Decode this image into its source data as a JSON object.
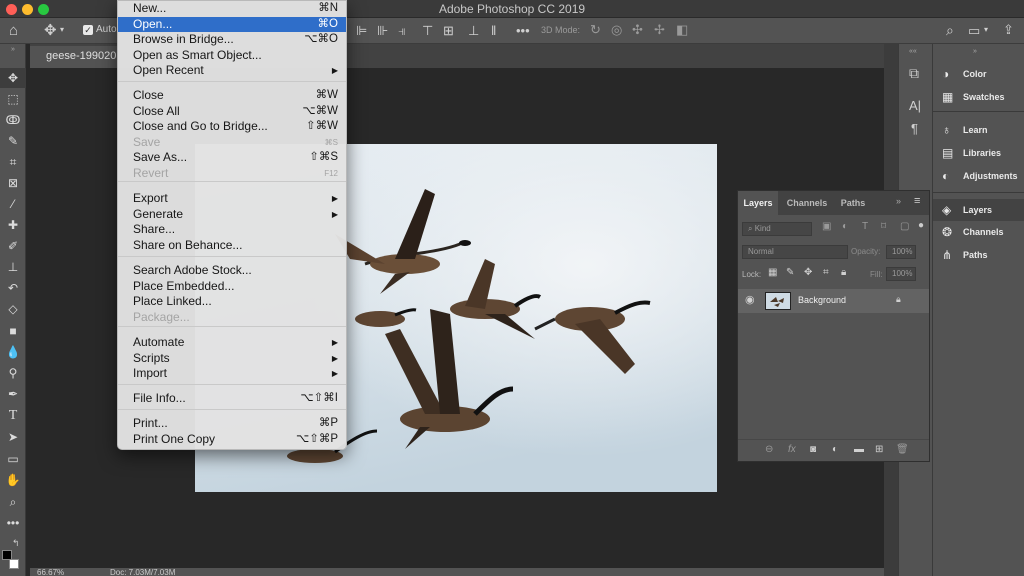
{
  "app": {
    "title": "Adobe Photoshop CC 2019",
    "traffic_lights": [
      "#ff5f57",
      "#febc2e",
      "#28c840"
    ]
  },
  "options_bar": {
    "home_icon": "home-icon",
    "move_icon": "move-icon",
    "auto_select_label": "Auto",
    "mode_3d_label": "3D Mode:",
    "search_icon": "search-icon",
    "workspace_icon": "workspace-icon",
    "share_icon": "share-icon"
  },
  "document": {
    "tab_label": "geese-199020"
  },
  "status_bar": {
    "zoom": "66.67%",
    "doc_size": "Doc: 7.03M/7.03M"
  },
  "file_menu": {
    "items": [
      {
        "label": "New...",
        "shortcut": "⌘N",
        "enabled": true
      },
      {
        "label": "Open...",
        "shortcut": "⌘O",
        "enabled": true,
        "highlighted": true
      },
      {
        "label": "Browse in Bridge...",
        "shortcut": "⌥⌘O",
        "enabled": true
      },
      {
        "label": "Open as Smart Object...",
        "shortcut": "",
        "enabled": true
      },
      {
        "label": "Open Recent",
        "shortcut": "▶",
        "enabled": true
      },
      {
        "label": "Close",
        "shortcut": "⌘W",
        "enabled": true
      },
      {
        "label": "Close All",
        "shortcut": "⌥⌘W",
        "enabled": true
      },
      {
        "label": "Close and Go to Bridge...",
        "shortcut": "⇧⌘W",
        "enabled": true
      },
      {
        "label": "Save",
        "shortcut": "⌘S",
        "enabled": false
      },
      {
        "label": "Save As...",
        "shortcut": "⇧⌘S",
        "enabled": true
      },
      {
        "label": "Revert",
        "shortcut": "F12",
        "enabled": false
      },
      {
        "label": "Export",
        "shortcut": "▶",
        "enabled": true
      },
      {
        "label": "Generate",
        "shortcut": "▶",
        "enabled": true
      },
      {
        "label": "Share...",
        "shortcut": "",
        "enabled": true
      },
      {
        "label": "Share on Behance...",
        "shortcut": "",
        "enabled": true
      },
      {
        "label": "Search Adobe Stock...",
        "shortcut": "",
        "enabled": true
      },
      {
        "label": "Place Embedded...",
        "shortcut": "",
        "enabled": true
      },
      {
        "label": "Place Linked...",
        "shortcut": "",
        "enabled": true
      },
      {
        "label": "Package...",
        "shortcut": "",
        "enabled": false
      },
      {
        "label": "Automate",
        "shortcut": "▶",
        "enabled": true
      },
      {
        "label": "Scripts",
        "shortcut": "▶",
        "enabled": true
      },
      {
        "label": "Import",
        "shortcut": "▶",
        "enabled": true
      },
      {
        "label": "File Info...",
        "shortcut": "⌥⇧⌘I",
        "enabled": true
      },
      {
        "label": "Print...",
        "shortcut": "⌘P",
        "enabled": true
      },
      {
        "label": "Print One Copy",
        "shortcut": "⌥⇧⌘P",
        "enabled": true
      }
    ]
  },
  "layers_panel": {
    "tabs": [
      "Layers",
      "Channels",
      "Paths"
    ],
    "active_tab": "Layers",
    "kind_filter": "Kind",
    "blend_mode": "Normal",
    "opacity_label": "Opacity:",
    "opacity_value": "100%",
    "lock_label": "Lock:",
    "fill_label": "Fill:",
    "fill_value": "100%",
    "layers": [
      {
        "name": "Background",
        "visible": true,
        "locked": true
      }
    ]
  },
  "right_dock": {
    "items": [
      {
        "label": "Color",
        "icon": "color-wheel-icon"
      },
      {
        "label": "Swatches",
        "icon": "swatches-grid-icon"
      },
      {
        "label": "Learn",
        "icon": "lightbulb-icon"
      },
      {
        "label": "Libraries",
        "icon": "libraries-icon"
      },
      {
        "label": "Adjustments",
        "icon": "adjustments-icon"
      },
      {
        "label": "Layers",
        "icon": "layers-icon",
        "selected": true
      },
      {
        "label": "Channels",
        "icon": "channels-icon"
      },
      {
        "label": "Paths",
        "icon": "paths-icon"
      }
    ]
  },
  "icon_column": {
    "items": [
      "history-icon",
      "character-icon",
      "paragraph-icon"
    ],
    "glyphs": [
      "A|",
      "¶"
    ]
  },
  "toolbar": {
    "tools": [
      "move-tool",
      "marquee-tool",
      "lasso-tool",
      "quick-select-tool",
      "crop-tool",
      "frame-tool",
      "eyedropper-tool",
      "healing-tool",
      "brush-tool",
      "stamp-tool",
      "history-brush-tool",
      "eraser-tool",
      "gradient-tool",
      "blur-tool",
      "dodge-tool",
      "pen-tool",
      "type-tool",
      "path-select-tool",
      "rectangle-tool",
      "hand-tool",
      "zoom-tool",
      "more-tools"
    ]
  }
}
